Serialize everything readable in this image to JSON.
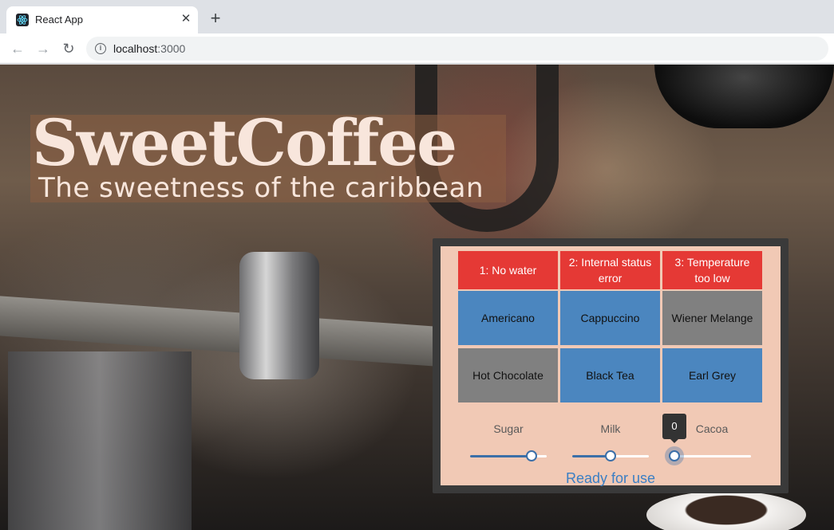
{
  "browser": {
    "tab_title": "React App",
    "tab_close": "✕",
    "new_tab": "+",
    "url_host": "localhost",
    "url_port": ":3000"
  },
  "hero": {
    "title": "SweetCoffee",
    "subtitle": "The sweetness of the caribbean"
  },
  "machine": {
    "errors": [
      {
        "label": "1: No water"
      },
      {
        "label": "2: Internal status error"
      },
      {
        "label": "3: Temperature too low"
      }
    ],
    "beverages": [
      {
        "label": "Americano",
        "color": "#4b86bf"
      },
      {
        "label": "Cappuccino",
        "color": "#4b86bf"
      },
      {
        "label": "Wiener Melange",
        "color": "#808080"
      },
      {
        "label": "Hot Chocolate",
        "color": "#808080"
      },
      {
        "label": "Black Tea",
        "color": "#4b86bf"
      },
      {
        "label": "Earl Grey",
        "color": "#4b86bf"
      }
    ],
    "sliders": [
      {
        "label": "Sugar",
        "value_fraction": 0.8
      },
      {
        "label": "Milk",
        "value_fraction": 0.5
      },
      {
        "label": "Cacoa",
        "value_fraction": 0.0,
        "tooltip": "0"
      }
    ],
    "status": "Ready for use"
  },
  "colors": {
    "error": "#e53935",
    "accent": "#3b6fa8",
    "status_text": "#3b7fc4",
    "panel_background": "#f1c9b5"
  }
}
